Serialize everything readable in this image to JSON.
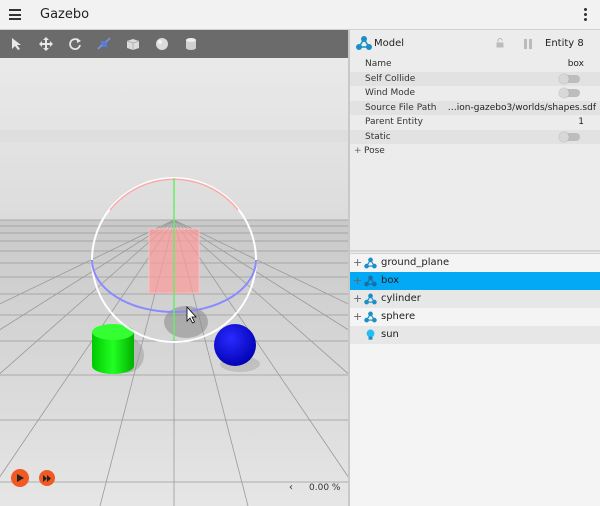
{
  "app": {
    "title": "Gazebo"
  },
  "toolbar": {
    "tools": [
      {
        "name": "select-tool-icon"
      },
      {
        "name": "translate-tool-icon"
      },
      {
        "name": "rotate-tool-icon"
      },
      {
        "name": "transform-control-icon"
      },
      {
        "name": "box-shape-icon"
      },
      {
        "name": "sphere-shape-icon"
      },
      {
        "name": "cylinder-shape-icon"
      }
    ]
  },
  "component_inspector": {
    "type_label": "Model",
    "entity_label": "Entity 8",
    "properties": {
      "name": {
        "label": "Name",
        "value": "box"
      },
      "self_collide": {
        "label": "Self Collide"
      },
      "wind_mode": {
        "label": "Wind Mode"
      },
      "source_file": {
        "label": "Source File Path",
        "value": "…ion-gazebo3/worlds/shapes.sdf"
      },
      "parent_entity": {
        "label": "Parent Entity",
        "value": "1"
      },
      "static": {
        "label": "Static"
      },
      "pose": {
        "label": "Pose",
        "expander": "+"
      }
    }
  },
  "entity_tree": {
    "items": [
      {
        "label": "ground_plane",
        "expander": "+"
      },
      {
        "label": "box",
        "expander": "+"
      },
      {
        "label": "cylinder",
        "expander": "+"
      },
      {
        "label": "sphere",
        "expander": "+"
      },
      {
        "label": "sun",
        "expander": ""
      }
    ]
  },
  "playback": {
    "real_time_factor": "0.00 %",
    "arrow": "‹"
  },
  "colors": {
    "accent": "#03a9f4",
    "play": "#f05a22",
    "cylinder": "#00dd00",
    "sphere": "#0000ee",
    "toolbar": "#6b6b6b"
  }
}
